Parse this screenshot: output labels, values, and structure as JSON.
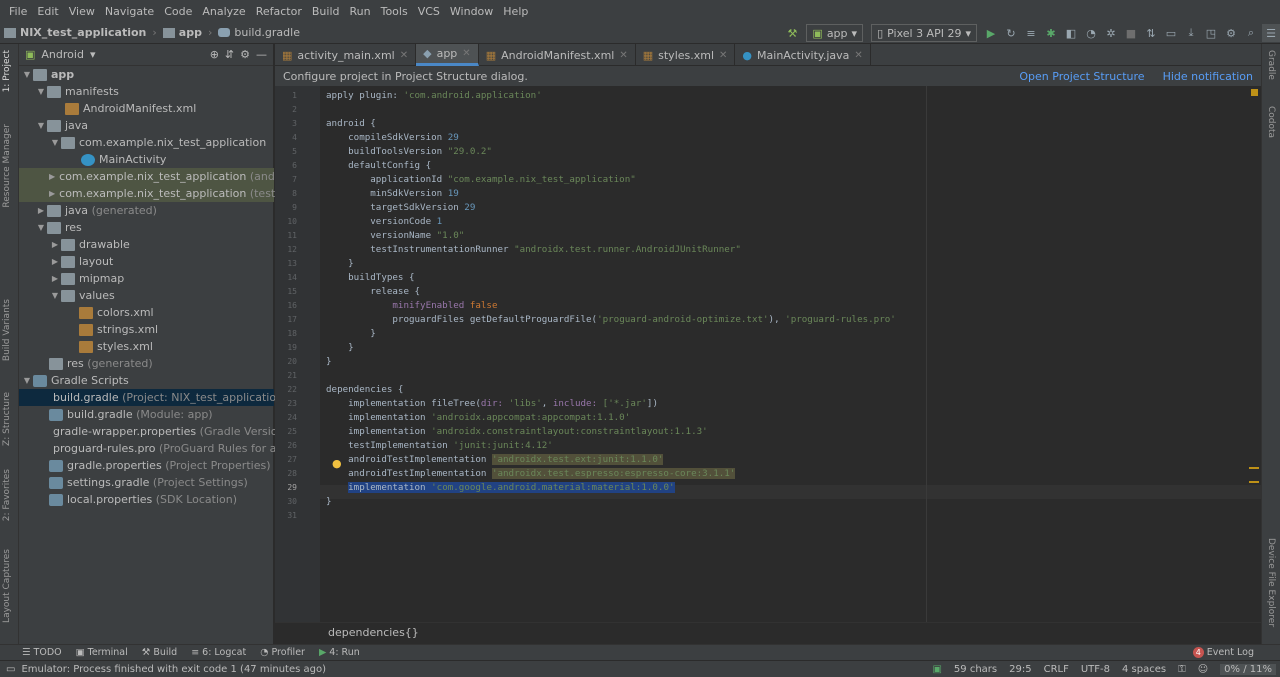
{
  "menu": [
    "File",
    "Edit",
    "View",
    "Navigate",
    "Code",
    "Analyze",
    "Refactor",
    "Build",
    "Run",
    "Tools",
    "VCS",
    "Window",
    "Help"
  ],
  "nav": {
    "project": "NIX_test_application",
    "module": "app",
    "file": "build.gradle"
  },
  "toolbar": {
    "run_config": "app",
    "device": "Pixel 3 API 29"
  },
  "left_strip": {
    "project": "1: Project",
    "resource_manager": "Resource Manager",
    "build_variants": "Build Variants",
    "structure": "Z: Structure",
    "favorites": "2: Favorites",
    "layout_captures": "Layout Captures"
  },
  "right_strip": {
    "gradle": "Gradle",
    "codota": "Codota",
    "device_explorer": "Device File Explorer"
  },
  "project": {
    "view": "Android",
    "tree": [
      {
        "label": "app",
        "extra": ""
      },
      {
        "label": "manifests",
        "extra": ""
      },
      {
        "label": "AndroidManifest.xml",
        "extra": ""
      },
      {
        "label": "java",
        "extra": ""
      },
      {
        "label": "com.example.nix_test_application",
        "extra": ""
      },
      {
        "label": "MainActivity",
        "extra": ""
      },
      {
        "label": "com.example.nix_test_application",
        "extra": "(androidT"
      },
      {
        "label": "com.example.nix_test_application",
        "extra": "(test)"
      },
      {
        "label": "java",
        "extra": "(generated)"
      },
      {
        "label": "res",
        "extra": ""
      },
      {
        "label": "drawable",
        "extra": ""
      },
      {
        "label": "layout",
        "extra": ""
      },
      {
        "label": "mipmap",
        "extra": ""
      },
      {
        "label": "values",
        "extra": ""
      },
      {
        "label": "colors.xml",
        "extra": ""
      },
      {
        "label": "strings.xml",
        "extra": ""
      },
      {
        "label": "styles.xml",
        "extra": ""
      },
      {
        "label": "res",
        "extra": "(generated)"
      },
      {
        "label": "Gradle Scripts",
        "extra": ""
      },
      {
        "label": "build.gradle",
        "extra": "(Project: NIX_test_application)"
      },
      {
        "label": "build.gradle",
        "extra": "(Module: app)"
      },
      {
        "label": "gradle-wrapper.properties",
        "extra": "(Gradle Version)"
      },
      {
        "label": "proguard-rules.pro",
        "extra": "(ProGuard Rules for app)"
      },
      {
        "label": "gradle.properties",
        "extra": "(Project Properties)"
      },
      {
        "label": "settings.gradle",
        "extra": "(Project Settings)"
      },
      {
        "label": "local.properties",
        "extra": "(SDK Location)"
      }
    ]
  },
  "tabs": [
    "activity_main.xml",
    "app",
    "AndroidManifest.xml",
    "styles.xml",
    "MainActivity.java"
  ],
  "notification": {
    "text": "Configure project in Project Structure dialog.",
    "open": "Open Project Structure",
    "hide": "Hide notification"
  },
  "code": {
    "line_numbers": [
      "1",
      "2",
      "3",
      "4",
      "5",
      "6",
      "7",
      "8",
      "9",
      "10",
      "11",
      "12",
      "13",
      "14",
      "15",
      "16",
      "17",
      "18",
      "19",
      "20",
      "21",
      "22",
      "23",
      "24",
      "25",
      "26",
      "27",
      "28",
      "29",
      "30",
      "31"
    ],
    "l1a": "apply plugin: ",
    "l1b": "'com.android.application'",
    "l3": "android {",
    "l4a": "    compileSdkVersion ",
    "l4b": "29",
    "l5a": "    buildToolsVersion ",
    "l5b": "\"29.0.2\"",
    "l6": "    defaultConfig {",
    "l7a": "        applicationId ",
    "l7b": "\"com.example.nix_test_application\"",
    "l8a": "        minSdkVersion ",
    "l8b": "19",
    "l9a": "        targetSdkVersion ",
    "l9b": "29",
    "l10a": "        versionCode ",
    "l10b": "1",
    "l11a": "        versionName ",
    "l11b": "\"1.0\"",
    "l12a": "        testInstrumentationRunner ",
    "l12b": "\"androidx.test.runner.AndroidJUnitRunner\"",
    "l13": "    }",
    "l14": "    buildTypes {",
    "l15": "        release {",
    "l16a": "            minifyEnabled ",
    "l16b": "false",
    "l17a": "            proguardFiles ",
    "l17b": "getDefaultProguardFile(",
    "l17c": "'proguard-android-optimize.txt'",
    "l17d": "), ",
    "l17e": "'proguard-rules.pro'",
    "l18": "        }",
    "l19": "    }",
    "l20": "}",
    "l22": "dependencies {",
    "l23a": "    implementation ",
    "l23b": "fileTree(",
    "l23c": "dir: ",
    "l23d": "'libs'",
    "l23e": ", ",
    "l23f": "include: ",
    "l23g": "['*.jar'",
    "l23h": "])",
    "l24a": "    implementation ",
    "l24b": "'androidx.appcompat:appcompat:1.1.0'",
    "l25a": "    implementation ",
    "l25b": "'androidx.constraintlayout:constraintlayout:1.1.3'",
    "l26a": "    testImplementation ",
    "l26b": "'junit:junit:4.12'",
    "l27a": "    androidTestImplementation ",
    "l27b": "'androidx.test.ext:junit:1.1.0'",
    "l28a": "    androidTestImplementation ",
    "l28b": "'androidx.test.espresso:espresso-core:3.1.1'",
    "l29a": "    ",
    "l29b": "implementation ",
    "l29c": "'com.google.android.material:material:1.0.0'",
    "l30": "}"
  },
  "breadcrumb": "dependencies{}",
  "bottom_tools": [
    "TODO",
    "Terminal",
    "Build",
    "6: Logcat",
    "Profiler",
    "4: Run"
  ],
  "event_log": {
    "count": "4",
    "label": "Event Log"
  },
  "status": {
    "message": "Emulator: Process finished with exit code 1 (47 minutes ago)",
    "chars": "59 chars",
    "position": "29:5",
    "line_sep": "CRLF",
    "encoding": "UTF-8",
    "indent": "4 spaces",
    "memory": "0% / 11%"
  },
  "colors": {
    "accent": "#4a88c7",
    "link": "#589df6",
    "selection": "#214283",
    "string": "#6a8759",
    "number": "#6897bb",
    "keyword": "#cc7832"
  }
}
